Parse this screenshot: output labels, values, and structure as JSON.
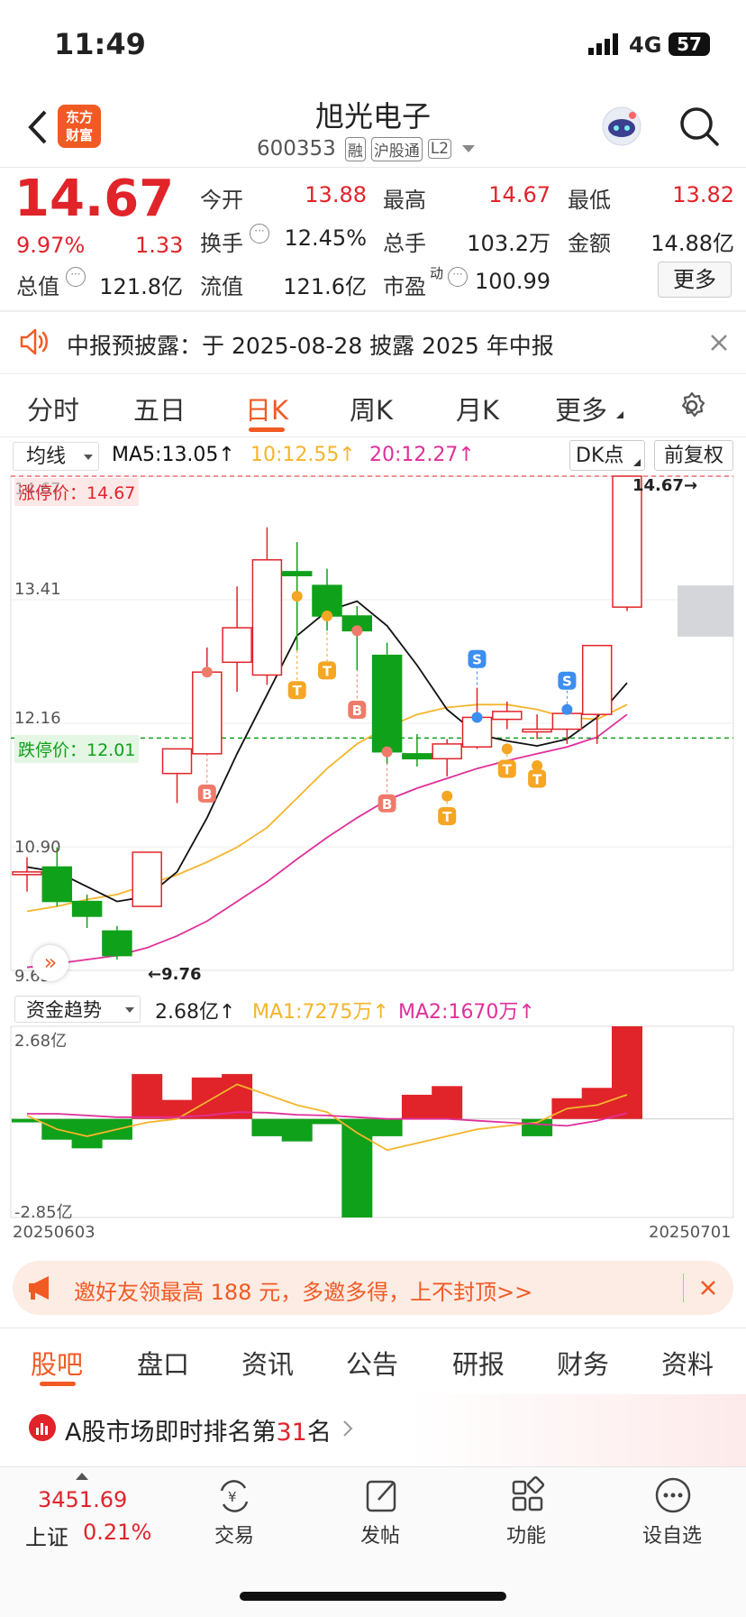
{
  "status": {
    "time": "11:49",
    "network": "4G",
    "battery": "57"
  },
  "header": {
    "title": "旭光电子",
    "code": "600353",
    "tags": [
      "融",
      "沪股通",
      "L2"
    ],
    "logo_text": [
      "东方",
      "财富"
    ]
  },
  "quote": {
    "price": "14.67",
    "change_pct": "9.97%",
    "change": "1.33",
    "open_label": "今开",
    "open": "13.88",
    "high_label": "最高",
    "high": "14.67",
    "low_label": "最低",
    "low": "13.82",
    "turnover_label": "换手",
    "turnover": "12.45%",
    "volume_label": "总手",
    "volume": "103.2万",
    "amount_label": "金额",
    "amount": "14.88亿",
    "mktcap_label": "总值",
    "mktcap": "121.8亿",
    "float_label": "流值",
    "float": "121.6亿",
    "pe_label": "市盈",
    "pe_sup": "动",
    "pe": "100.99",
    "more_btn": "更多"
  },
  "notice": {
    "text": "中报预披露：于 2025-08-28 披露 2025 年中报"
  },
  "tabs": [
    "分时",
    "五日",
    "日K",
    "周K",
    "月K",
    "更多"
  ],
  "active_tab": 2,
  "kline_bar": {
    "ma_select": "均线",
    "ma5": "MA5:13.05",
    "ma10": "10:12.55",
    "ma20": "20:12.27",
    "dk_btn": "DK点",
    "adjust_btn": "前复权"
  },
  "price_axis": [
    "14.67",
    "13.41",
    "12.16",
    "10.90",
    "9.65"
  ],
  "limit_up_label": "涨停价：14.67",
  "limit_down_label": "跌停价：12.01",
  "last_price_marker": "14.67",
  "min_marker": "9.76",
  "flow_bar": {
    "select": "资金趋势",
    "value": "2.68亿",
    "ma1": "MA1:7275万",
    "ma2": "MA2:1670万"
  },
  "flow_axis": {
    "top": "2.68亿",
    "bottom": "-2.85亿"
  },
  "date_start": "20250603",
  "date_end": "20250701",
  "promo": {
    "text": "邀好友领最高 188 元，多邀多得，上不封顶>>"
  },
  "bottom_tabs": [
    "股吧",
    "盘口",
    "资讯",
    "公告",
    "研报",
    "财务",
    "资料"
  ],
  "rank": {
    "prefix": "A股市场即时排名第",
    "num": "31",
    "suffix": "名"
  },
  "nav": {
    "index_value": "3451.69",
    "index_name": "上证",
    "index_pct": "0.21%",
    "items": [
      "交易",
      "发帖",
      "功能",
      "设自选"
    ]
  },
  "colors": {
    "up": "#e0242a",
    "down": "#10a11a",
    "ma5": "#111111",
    "ma10": "#f5b52b",
    "ma20": "#e0309a",
    "accent": "#ff5a1f"
  },
  "chart_data": {
    "type": "candlestick",
    "candles": [
      {
        "o": 10.65,
        "c": 10.65,
        "h": 10.8,
        "l": 10.45
      },
      {
        "o": 10.7,
        "c": 10.35,
        "h": 10.9,
        "l": 10.3
      },
      {
        "o": 10.35,
        "c": 10.2,
        "h": 10.42,
        "l": 10.08
      },
      {
        "o": 10.05,
        "c": 9.8,
        "h": 10.1,
        "l": 9.76
      },
      {
        "o": 10.3,
        "c": 10.85,
        "h": 10.85,
        "l": 10.3
      },
      {
        "o": 11.65,
        "c": 11.9,
        "h": 11.9,
        "l": 11.35
      },
      {
        "o": 11.85,
        "c": 12.68,
        "h": 12.93,
        "l": 11.85
      },
      {
        "o": 12.78,
        "c": 13.13,
        "h": 13.55,
        "l": 12.48
      },
      {
        "o": 12.65,
        "c": 13.82,
        "h": 14.15,
        "l": 12.55
      },
      {
        "o": 13.7,
        "c": 13.66,
        "h": 14.0,
        "l": 12.9
      },
      {
        "o": 13.56,
        "c": 13.25,
        "h": 13.73,
        "l": 13.1
      },
      {
        "o": 13.25,
        "c": 13.1,
        "h": 13.35,
        "l": 12.7
      },
      {
        "o": 12.85,
        "c": 11.87,
        "h": 12.98,
        "l": 11.75
      },
      {
        "o": 11.85,
        "c": 11.8,
        "h": 12.05,
        "l": 11.72
      },
      {
        "o": 11.8,
        "c": 11.95,
        "h": 12.0,
        "l": 11.62
      },
      {
        "o": 11.92,
        "c": 12.22,
        "h": 12.52,
        "l": 11.9
      },
      {
        "o": 12.2,
        "c": 12.28,
        "h": 12.38,
        "l": 12.1
      },
      {
        "o": 12.1,
        "c": 12.1,
        "h": 12.25,
        "l": 12.0
      },
      {
        "o": 12.1,
        "c": 12.26,
        "h": 12.3,
        "l": 11.95
      },
      {
        "o": 12.25,
        "c": 12.95,
        "h": 12.95,
        "l": 11.95
      },
      {
        "o": 13.34,
        "c": 14.67,
        "h": 14.67,
        "l": 13.3
      }
    ],
    "ma5": [
      10.7,
      10.65,
      10.5,
      10.35,
      10.4,
      10.65,
      11.2,
      11.85,
      12.45,
      13.05,
      13.3,
      13.4,
      13.15,
      12.75,
      12.3,
      12.05,
      11.98,
      11.93,
      12.0,
      12.22,
      12.57
    ],
    "ma10": [
      10.25,
      10.3,
      10.37,
      10.42,
      10.52,
      10.62,
      10.75,
      10.9,
      11.1,
      11.4,
      11.7,
      11.95,
      12.12,
      12.25,
      12.32,
      12.35,
      12.35,
      12.3,
      12.22,
      12.2,
      12.35
    ],
    "ma20": [
      9.68,
      9.72,
      9.76,
      9.8,
      9.88,
      10.0,
      10.15,
      10.35,
      10.55,
      10.78,
      11.0,
      11.2,
      11.38,
      11.5,
      11.6,
      11.7,
      11.78,
      11.85,
      11.92,
      12.02,
      12.25
    ],
    "flow": [
      -0.1,
      -0.6,
      -0.85,
      -0.6,
      1.3,
      0.55,
      1.2,
      1.3,
      -0.5,
      -0.65,
      -0.15,
      -2.85,
      -0.5,
      0.7,
      0.95,
      0,
      0,
      -0.5,
      0.6,
      0.9,
      2.68
    ],
    "flow_ma1": [
      0.1,
      -0.3,
      -0.5,
      -0.3,
      -0.1,
      0.0,
      0.5,
      1.0,
      0.7,
      0.4,
      0.2,
      -0.4,
      -0.9,
      -0.7,
      -0.5,
      -0.3,
      -0.2,
      -0.1,
      0.3,
      0.4,
      0.7
    ],
    "flow_ma2": [
      0.15,
      0.15,
      0.1,
      0.05,
      0.05,
      0.05,
      0.1,
      0.2,
      0.18,
      0.12,
      0.1,
      0.05,
      0.0,
      0.0,
      0.0,
      -0.05,
      -0.1,
      -0.15,
      -0.2,
      -0.05,
      0.17
    ],
    "signals": [
      {
        "i": 6,
        "t": "B",
        "dot": 12.68
      },
      {
        "i": 9,
        "t": "T",
        "dot": 13.45
      },
      {
        "i": 10,
        "t": "T",
        "dot": 13.25
      },
      {
        "i": 11,
        "t": "B",
        "dot": 13.1
      },
      {
        "i": 12,
        "t": "B",
        "dot": 11.87
      },
      {
        "i": 14,
        "t": "T",
        "dot": 11.42
      },
      {
        "i": 15,
        "t": "S",
        "dot": 12.22
      },
      {
        "i": 16,
        "t": "T",
        "dot": 11.9
      },
      {
        "i": 17,
        "t": "T",
        "dot": 11.73
      },
      {
        "i": 18,
        "t": "S",
        "dot": 12.3
      }
    ],
    "ylim": [
      9.65,
      14.67
    ],
    "limit_up": 14.67,
    "limit_down": 12.01
  }
}
